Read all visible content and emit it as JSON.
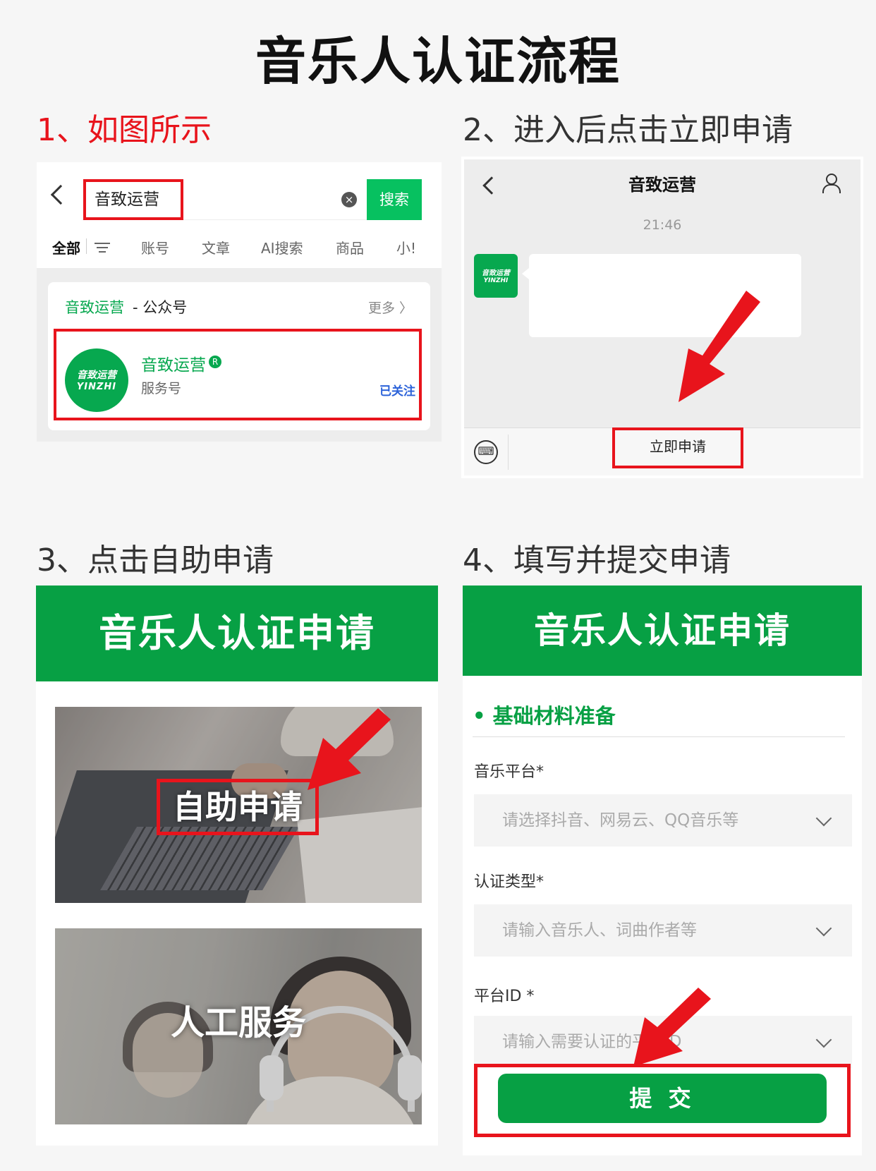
{
  "main_title": "音乐人认证流程",
  "steps": {
    "s1": "1、如图所示",
    "s2": "2、进入后点击立即申请",
    "s3": "3、点击自助申请",
    "s4": "4、填写并提交申请"
  },
  "panel1": {
    "search_query": "音致运营",
    "search_button": "搜索",
    "clear_icon": "×",
    "tabs": [
      "全部",
      "账号",
      "文章",
      "AI搜索",
      "商品",
      "小!"
    ],
    "section_name": "音致运营",
    "section_suffix": "- 公众号",
    "more": "更多 〉",
    "result_name": "音致运营",
    "verified_mark": "R",
    "result_type": "服务号",
    "follow_status": "已关注",
    "avatar_line1": "音致运营",
    "avatar_line2": "YINZHI"
  },
  "panel2": {
    "title": "音致运营",
    "time": "21:46",
    "avatar_line1": "音致运营",
    "avatar_line2": "YINZHI",
    "keyboard_glyph": "⌨",
    "apply_button": "立即申请"
  },
  "panel3": {
    "header": "音乐人认证申请",
    "self_service": "自助申请",
    "manual_service": "人工服务"
  },
  "panel4": {
    "header": "音乐人认证申请",
    "section_title": "• 基础材料准备",
    "field1_label": "音乐平台*",
    "field1_placeholder": "请选择抖音、网易云、QQ音乐等",
    "field2_label": "认证类型*",
    "field2_placeholder": "请输入音乐人、词曲作者等",
    "field3_label": "平台ID *",
    "field3_placeholder": "请输入需要认证的平台ID",
    "submit": "提 交"
  },
  "colors": {
    "brand_green": "#07a044",
    "wechat_green": "#07c160",
    "highlight_red": "#e8141c"
  }
}
